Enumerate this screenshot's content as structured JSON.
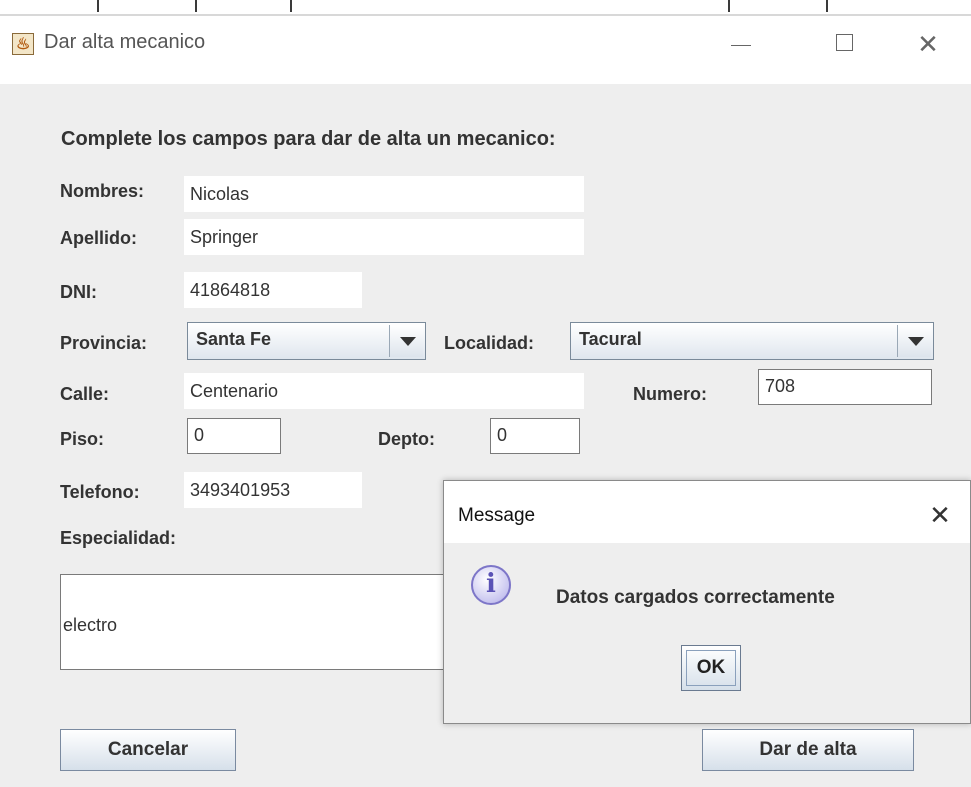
{
  "window": {
    "title": "Dar alta mecanico",
    "app_icon": "java-cup-icon",
    "controls": {
      "minimize": "—",
      "maximize": "□",
      "close": "✕"
    }
  },
  "form": {
    "heading": "Complete los campos para dar de alta un mecanico:",
    "nombres_label": "Nombres:",
    "nombres_value": "Nicolas",
    "apellido_label": "Apellido:",
    "apellido_value": "Springer",
    "dni_label": "DNI:",
    "dni_value": "41864818",
    "provincia_label": "Provincia:",
    "provincia_value": "Santa Fe",
    "localidad_label": "Localidad:",
    "localidad_value": "Tacural",
    "calle_label": "Calle:",
    "calle_value": "Centenario",
    "numero_label": "Numero:",
    "numero_value": "708",
    "piso_label": "Piso:",
    "piso_value": "0",
    "depto_label": "Depto:",
    "depto_value": "0",
    "telefono_label": "Telefono:",
    "telefono_value": "3493401953",
    "especialidad_label": "Especialidad:",
    "especialidad_value": "electro"
  },
  "buttons": {
    "cancelar": "Cancelar",
    "dar_de_alta": "Dar de alta"
  },
  "dialog": {
    "title": "Message",
    "close": "✕",
    "icon": "info-icon",
    "message": "Datos cargados correctamente",
    "ok": "OK"
  },
  "colors": {
    "window_bg": "#eeeeee",
    "button_gradient_bottom": "#d6e0ea",
    "info_icon": "#7d76c8"
  }
}
